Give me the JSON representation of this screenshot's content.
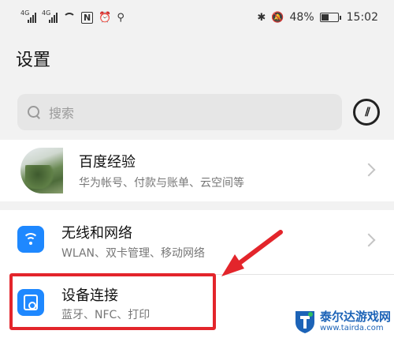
{
  "status_bar": {
    "signal1_label": "4G",
    "signal2_label": "4G",
    "nfc": "N",
    "battery_percent": "48%",
    "battery_level": 0.48,
    "time": "15:02"
  },
  "header": {
    "title": "设置"
  },
  "search": {
    "placeholder": "搜索"
  },
  "account": {
    "title": "百度经验",
    "subtitle": "华为帐号、付款与账单、云空间等"
  },
  "settings": {
    "items": [
      {
        "title": "无线和网络",
        "subtitle": "WLAN、双卡管理、移动网络",
        "icon": "wifi-icon",
        "icon_color": "#1e88ff"
      },
      {
        "title": "设备连接",
        "subtitle": "蓝牙、NFC、打印",
        "icon": "device-connection-icon",
        "icon_color": "#1e88ff"
      }
    ]
  },
  "annotation": {
    "highlight_color": "#e3252b"
  },
  "watermark": {
    "name": "泰尔达游戏网",
    "url": "www.tairda.com"
  }
}
